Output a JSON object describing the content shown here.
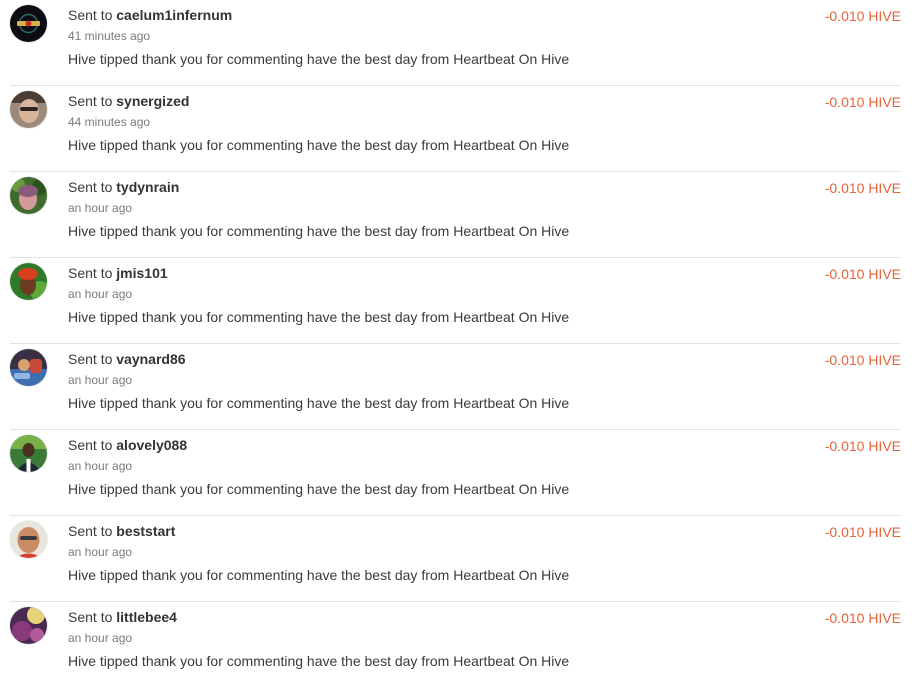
{
  "colors": {
    "amount": "#e3633a",
    "divider": "#e3e3e3",
    "muted": "#7a7a7a"
  },
  "transfers": [
    {
      "prefix": "Sent to",
      "user": "caelum1infernum",
      "time": "41 minutes ago",
      "memo": "Hive tipped thank you for commenting have the best day from Heartbeat On Hive",
      "amount": "-0.010 HIVE",
      "avatar_icon": "dark-logo-avatar"
    },
    {
      "prefix": "Sent to",
      "user": "synergized",
      "time": "44 minutes ago",
      "memo": "Hive tipped thank you for commenting have the best day from Heartbeat On Hive",
      "amount": "-0.010 HIVE",
      "avatar_icon": "person-avatar"
    },
    {
      "prefix": "Sent to",
      "user": "tydynrain",
      "time": "an hour ago",
      "memo": "Hive tipped thank you for commenting have the best day from Heartbeat On Hive",
      "amount": "-0.010 HIVE",
      "avatar_icon": "person-avatar"
    },
    {
      "prefix": "Sent to",
      "user": "jmis101",
      "time": "an hour ago",
      "memo": "Hive tipped thank you for commenting have the best day from Heartbeat On Hive",
      "amount": "-0.010 HIVE",
      "avatar_icon": "person-avatar"
    },
    {
      "prefix": "Sent to",
      "user": "vaynard86",
      "time": "an hour ago",
      "memo": "Hive tipped thank you for commenting have the best day from Heartbeat On Hive",
      "amount": "-0.010 HIVE",
      "avatar_icon": "illustration-avatar"
    },
    {
      "prefix": "Sent to",
      "user": "alovely088",
      "time": "an hour ago",
      "memo": "Hive tipped thank you for commenting have the best day from Heartbeat On Hive",
      "amount": "-0.010 HIVE",
      "avatar_icon": "person-avatar"
    },
    {
      "prefix": "Sent to",
      "user": "beststart",
      "time": "an hour ago",
      "memo": "Hive tipped thank you for commenting have the best day from Heartbeat On Hive",
      "amount": "-0.010 HIVE",
      "avatar_icon": "person-avatar"
    },
    {
      "prefix": "Sent to",
      "user": "littlebee4",
      "time": "an hour ago",
      "memo": "Hive tipped thank you for commenting have the best day from Heartbeat On Hive",
      "amount": "-0.010 HIVE",
      "avatar_icon": "illustration-avatar"
    }
  ]
}
